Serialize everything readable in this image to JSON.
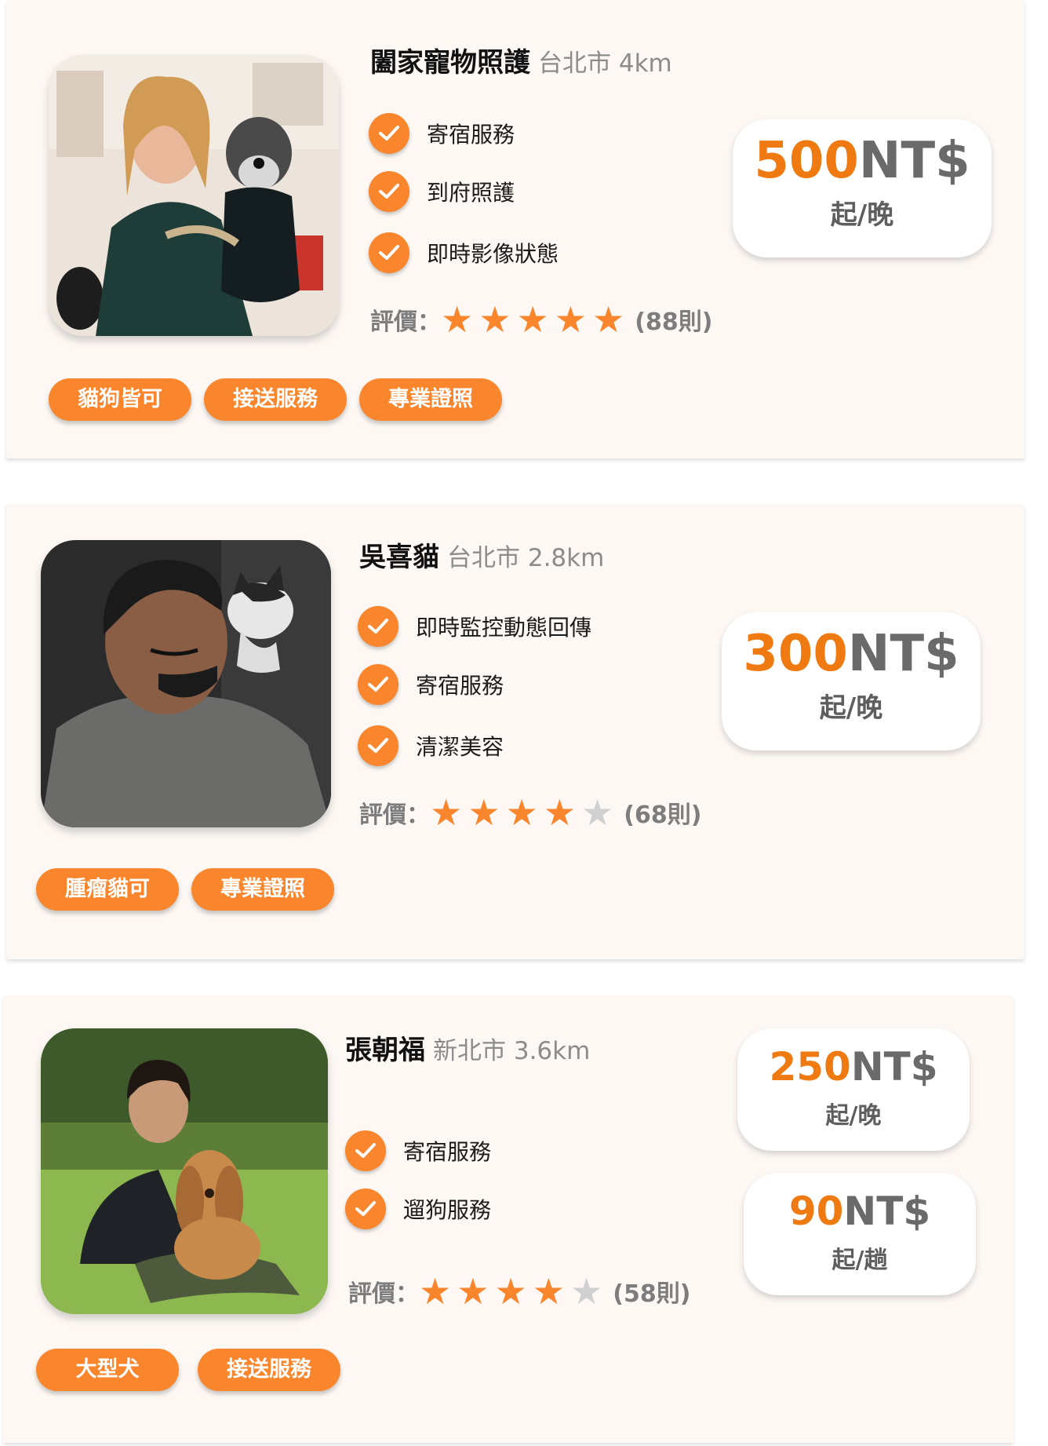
{
  "colors": {
    "accent": "#f9852d",
    "price_number": "#f07a12",
    "card_background": "#fdf8f4",
    "star_off": "#d0d0d0"
  },
  "icons": {
    "check": "check-icon",
    "star": "star-icon"
  },
  "sitters": [
    {
      "name": "闔家寵物照護",
      "location": "台北市 4km",
      "features": [
        "寄宿服務",
        "到府照護",
        "即時影像狀態"
      ],
      "rating_label": "評價：",
      "stars": 5,
      "review_count": "(88則)",
      "prices": [
        {
          "amount": "500",
          "currency": "NT$",
          "unit": "起/晚"
        }
      ],
      "tags": [
        "貓狗皆可",
        "接送服務",
        "專業證照"
      ]
    },
    {
      "name": "吳喜貓",
      "location": "台北市 2.8km",
      "features": [
        "即時監控動態回傳",
        "寄宿服務",
        "清潔美容"
      ],
      "rating_label": "評價：",
      "stars": 4,
      "review_count": "(68則)",
      "prices": [
        {
          "amount": "300",
          "currency": "NT$",
          "unit": "起/晚"
        }
      ],
      "tags": [
        "腫瘤貓可",
        "專業證照"
      ]
    },
    {
      "name": "張朝福",
      "location": "新北市 3.6km",
      "features": [
        "寄宿服務",
        "遛狗服務"
      ],
      "rating_label": "評價：",
      "stars": 4,
      "review_count": "(58則)",
      "prices": [
        {
          "amount": "250",
          "currency": "NT$",
          "unit": "起/晚"
        },
        {
          "amount": "90",
          "currency": "NT$",
          "unit": "起/趟"
        }
      ],
      "tags": [
        "大型犬",
        "接送服務"
      ]
    }
  ]
}
